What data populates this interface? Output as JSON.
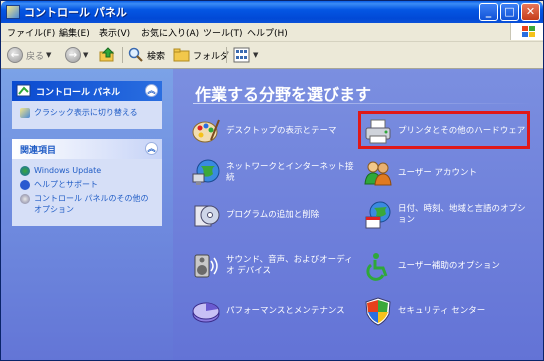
{
  "window": {
    "title": "コントロール パネル"
  },
  "menubar": {
    "items": [
      "ファイル(F)",
      "編集(E)",
      "表示(V)",
      "お気に入り(A)",
      "ツール(T)",
      "ヘルプ(H)"
    ]
  },
  "toolbar": {
    "back": "戻る",
    "search": "検索",
    "folders": "フォルダ"
  },
  "sidebar": {
    "cp_panel": {
      "title": "コントロール パネル",
      "switch_link": "クラシック表示に切り替える"
    },
    "related": {
      "title": "関連項目",
      "links": [
        "Windows Update",
        "ヘルプとサポート",
        "コントロール パネルのその他のオプション"
      ]
    }
  },
  "main": {
    "heading": "作業する分野を選びます",
    "categories": [
      "デスクトップの表示とテーマ",
      "プリンタとその他のハードウェア",
      "ネットワークとインターネット接続",
      "ユーザー アカウント",
      "プログラムの追加と削除",
      "日付、時刻、地域と言語のオプション",
      "サウンド、音声、およびオーディオ デバイス",
      "ユーザー補助のオプション",
      "パフォーマンスとメンテナンス",
      "セキュリティ センター"
    ]
  },
  "colors": {
    "title_bar": "#0454e0",
    "main_bg": "#6f80dc",
    "highlight": "#e01818",
    "link": "#215dc6"
  }
}
